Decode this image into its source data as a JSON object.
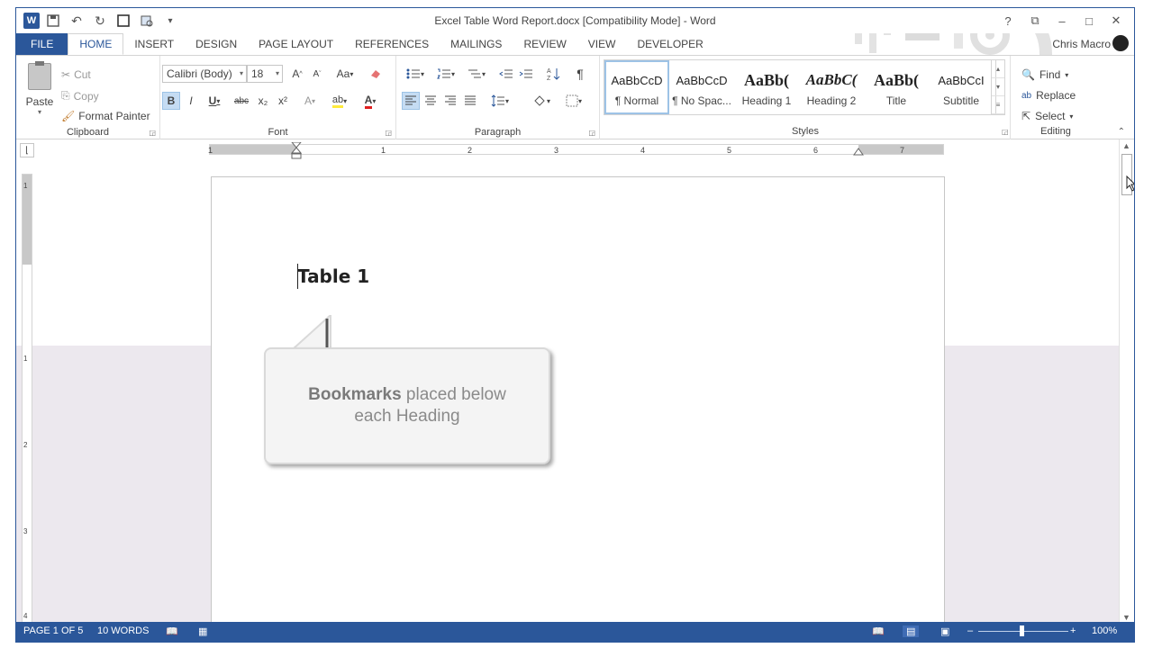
{
  "window": {
    "title": "Excel Table Word Report.docx [Compatibility Mode] - Word",
    "app_icon": "W",
    "controls": [
      "?",
      "⧉",
      "–",
      "□",
      "✕"
    ]
  },
  "quick_access": {
    "save_icon": "💾",
    "undo_icon": "↶",
    "redo_icon": "↻",
    "more_icon": "▾"
  },
  "tabs": [
    "FILE",
    "HOME",
    "INSERT",
    "DESIGN",
    "PAGE LAYOUT",
    "REFERENCES",
    "MAILINGS",
    "REVIEW",
    "VIEW",
    "DEVELOPER"
  ],
  "active_tab": "HOME",
  "user": {
    "name": "Chris Macro"
  },
  "clipboard": {
    "label": "Clipboard",
    "paste": "Paste",
    "cut": "Cut",
    "copy": "Copy",
    "format_painter": "Format Painter"
  },
  "font": {
    "label": "Font",
    "family": "Calibri (Body)",
    "size": "18",
    "grow": "A",
    "shrink": "A",
    "change_case": "Aa",
    "bold": "B",
    "italic": "I",
    "underline": "U",
    "strikethrough": "abc",
    "subscript": "x₂",
    "superscript": "x²",
    "text_effects": "A",
    "highlight": "ab",
    "font_color": "A"
  },
  "paragraph": {
    "label": "Paragraph",
    "show_marks": "¶"
  },
  "styles": {
    "label": "Styles",
    "items": [
      {
        "sample": "AaBbCcD",
        "name": "¶ Normal"
      },
      {
        "sample": "AaBbCcD",
        "name": "¶ No Spac..."
      },
      {
        "sample": "AaBb(",
        "name": "Heading 1"
      },
      {
        "sample": "AaBbC(",
        "name": "Heading 2"
      },
      {
        "sample": "AaBb(",
        "name": "Title"
      },
      {
        "sample": "AaBbCcI",
        "name": "Subtitle"
      }
    ]
  },
  "editing": {
    "label": "Editing",
    "find": "Find",
    "replace": "Replace",
    "select": "Select"
  },
  "ruler": {
    "marks": [
      "1",
      "1",
      "2",
      "3",
      "4",
      "5",
      "6",
      "7"
    ],
    "vmarks": [
      "1",
      "1",
      "2",
      "3",
      "4"
    ]
  },
  "document": {
    "heading": "Table 1",
    "callout_bold": "Bookmarks",
    "callout_rest": " placed below each Heading"
  },
  "status": {
    "page": "PAGE 1 OF 5",
    "words": "10 WORDS",
    "zoom": "100%"
  },
  "colors": {
    "accent": "#2b579a",
    "band": "#ece8ee"
  }
}
